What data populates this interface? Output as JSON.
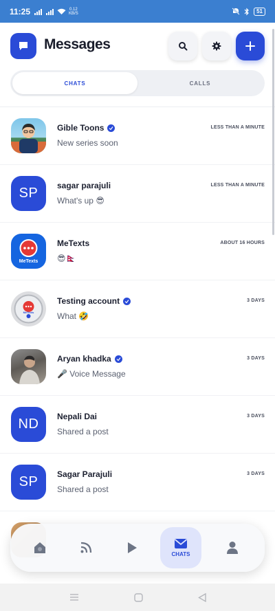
{
  "status_bar": {
    "time": "11:25",
    "net_speed_value": "0.12",
    "net_speed_unit": "KB/S",
    "battery": "51"
  },
  "header": {
    "title": "Messages",
    "icons": [
      "message-icon",
      "search-icon",
      "gear-icon",
      "plus-icon"
    ]
  },
  "tabs": [
    {
      "label": "CHATS",
      "active": true
    },
    {
      "label": "CALLS",
      "active": false
    }
  ],
  "chats": [
    {
      "name": "Gible Toons",
      "verified": true,
      "preview": "New series soon",
      "time": "LESS THAN A MINUTE",
      "avatar": "cartoon-person-avatar"
    },
    {
      "name": "sagar parajuli",
      "verified": false,
      "preview": "What's up 😎",
      "time": "LESS THAN A MINUTE",
      "initials": "SP"
    },
    {
      "name": "MeTexts",
      "verified": false,
      "preview": "😎🇳🇵",
      "time": "ABOUT 16 HOURS",
      "avatar": "metexts-logo",
      "logo_text": "MeTexts"
    },
    {
      "name": "Testing account",
      "verified": true,
      "preview": "What 🤣",
      "time": "3 DAYS",
      "avatar": "metexts-badge-logo",
      "logo_text": "MeTexts"
    },
    {
      "name": "Aryan khadka",
      "verified": true,
      "preview": "🎤 Voice Message",
      "time": "3 DAYS",
      "avatar": "photo-avatar"
    },
    {
      "name": "Nepali Dai",
      "verified": false,
      "preview": "Shared a post",
      "time": "3 DAYS",
      "initials": "ND"
    },
    {
      "name": "Sagar Parajuli",
      "verified": false,
      "preview": "Shared a post",
      "time": "3 DAYS",
      "initials": "SP"
    }
  ],
  "bottom_nav": {
    "items": [
      {
        "icon": "home-icon"
      },
      {
        "icon": "feed-icon"
      },
      {
        "icon": "play-icon"
      },
      {
        "icon": "mail-icon",
        "label": "CHATS",
        "active": true
      },
      {
        "icon": "person-icon"
      }
    ]
  },
  "colors": {
    "accent": "#2a4bd7",
    "status_bar": "#3b7fd0"
  }
}
